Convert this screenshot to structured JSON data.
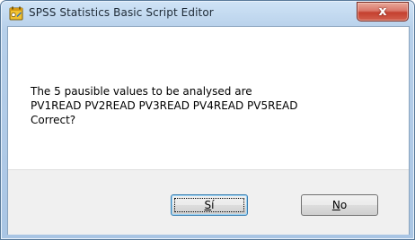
{
  "window": {
    "title": "SPSS Statistics Basic Script Editor",
    "close_glyph": "x"
  },
  "message": {
    "lines": [
      "The 5 pausible values to be analysed are",
      "PV1READ PV2READ PV3READ PV4READ PV5READ",
      "Correct?"
    ]
  },
  "buttons": {
    "yes": {
      "label": "Sí",
      "mnemonic": "S",
      "rest": "í"
    },
    "no": {
      "label": "No",
      "mnemonic": "N",
      "rest": "o"
    }
  },
  "icons": {
    "app": "spss-script-icon",
    "close": "close-icon"
  },
  "colors": {
    "titlebar": "#b7d0ea",
    "close_button": "#c4402f",
    "default_button_border": "#3c7fb1"
  }
}
